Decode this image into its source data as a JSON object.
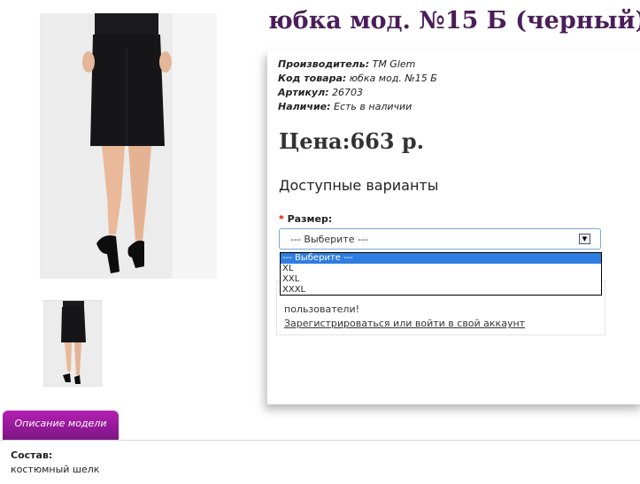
{
  "product": {
    "title": "юбка мод. №15 Б (черный)",
    "images": {
      "main_icon": "skirt-photo-icon",
      "thumbnail_icon": "skirt-thumbnail-icon"
    }
  },
  "specs": [
    {
      "label": "Производитель:",
      "value": "ТМ Glem"
    },
    {
      "label": "Код товара:",
      "value": "юбка мод. №15 Б"
    },
    {
      "label": "Артикул:",
      "value": "26703"
    },
    {
      "label": "Наличие:",
      "value": "Есть в наличии"
    }
  ],
  "price": "Цена:663 р.",
  "variants": {
    "title": "Доступные варианты",
    "required_mark": "*",
    "size_label": "Размер:",
    "selected": "--- Выберите ---",
    "options": [
      "--- Выберите ---",
      "XL",
      "XXL",
      "XXXL"
    ]
  },
  "notice": {
    "text": "пользователи!",
    "link": "Зарегистрироваться или войти в свой аккаунт"
  },
  "tabs": {
    "description": "Описание модели"
  },
  "description": {
    "label": "Состав:",
    "value": "костюмный шелк"
  },
  "colors": {
    "title": "#4a1e5a",
    "tab": "#9a1a9e",
    "selection": "#2f7de1"
  }
}
